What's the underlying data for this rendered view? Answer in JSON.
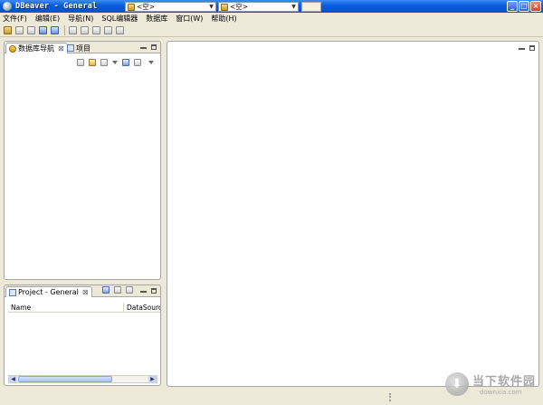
{
  "window": {
    "title": "DBeaver - General",
    "minimize": "_",
    "maximize": "□",
    "close": "×"
  },
  "menu": [
    "文件(F)",
    "编辑(E)",
    "导航(N)",
    "SQL编辑器",
    "数据库",
    "窗口(W)",
    "帮助(H)"
  ],
  "toolbar": {
    "combo1_text": "<空>",
    "combo2_text": "<空>"
  },
  "navigator_panel": {
    "tab_active": "数据库导航",
    "tab_other": "项目",
    "close_glyph": "⊠"
  },
  "project_panel": {
    "tab": "Project - General",
    "close_glyph": "⊠",
    "columns": [
      "Name",
      "DataSource"
    ]
  },
  "watermark": {
    "main": "当下软件园",
    "sub": "downxia.com"
  }
}
